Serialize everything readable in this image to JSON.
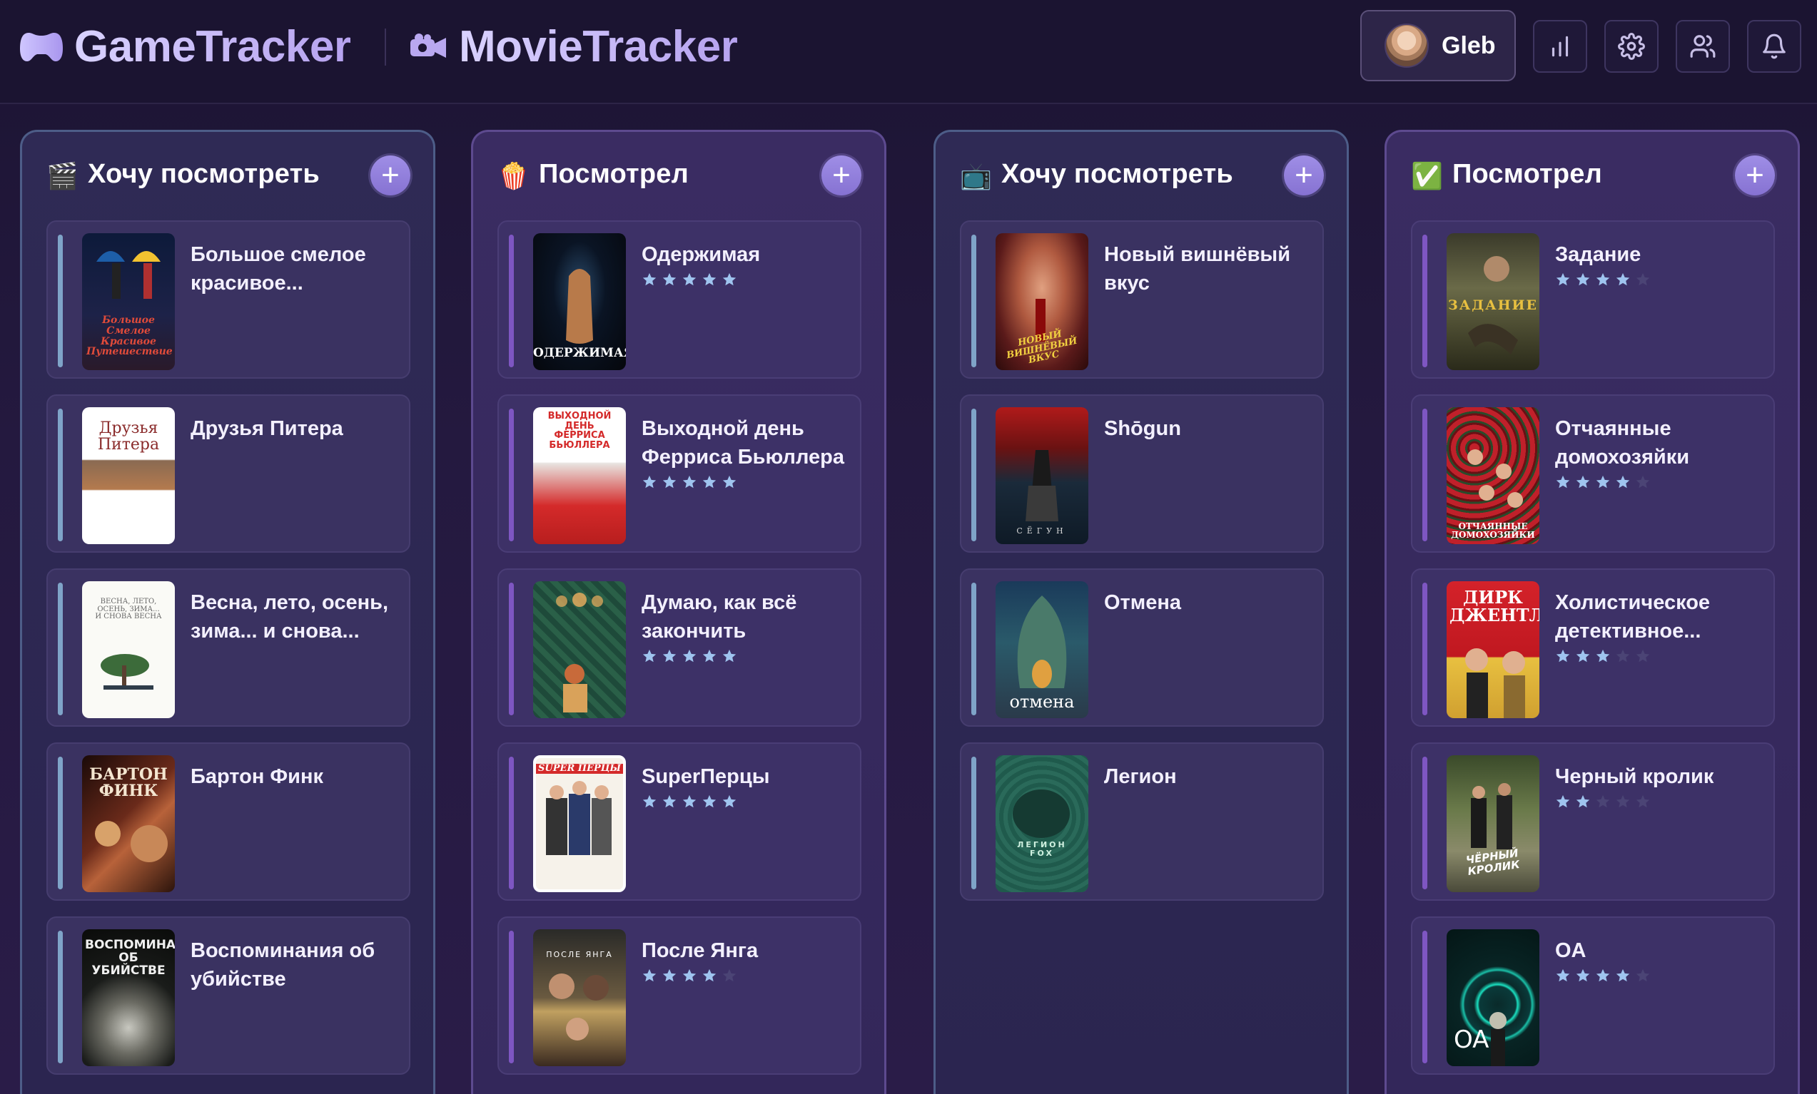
{
  "header": {
    "game_brand": "GameTracker",
    "movie_brand": "MovieTracker",
    "user_name": "Gleb",
    "icons": [
      "stats-icon",
      "settings-icon",
      "friends-icon",
      "bell-icon"
    ]
  },
  "colors": {
    "accent": "#8672d2",
    "blue_accent": "#7fa4c8",
    "purple_accent": "#7e56c2",
    "star_on": "#9fc4ef",
    "star_off": "#4b4475"
  },
  "columns": [
    {
      "emoji": "🎬",
      "title": "Хочу посмотреть",
      "cards": [
        {
          "title": "Большое смелое красивое...",
          "rating": null,
          "poster_text": "Большое Смелое Красивое Путешествие"
        },
        {
          "title": "Друзья Питера",
          "rating": null,
          "poster_text": "Друзья Питера"
        },
        {
          "title": "Весна, лето, осень, зима... и снова...",
          "rating": null,
          "poster_text": "ВЕСНА, ЛЕТО, ОСЕНЬ, ЗИМА... И СНОВА ВЕСНА"
        },
        {
          "title": "Бартон Финк",
          "rating": null,
          "poster_text": "БАРТОН ФИНК"
        },
        {
          "title": "Воспоминания об убийстве",
          "rating": null,
          "poster_text": "ВОСПОМИНАНИЯ ОБ УБИЙСТВЕ"
        }
      ]
    },
    {
      "emoji": "🍿",
      "title": "Посмотрел",
      "cards": [
        {
          "title": "Одержимая",
          "rating": 5,
          "poster_text": "ОДЕРЖИМАЯ"
        },
        {
          "title": "Выходной день Ферриса Бьюллера",
          "rating": 5,
          "poster_text": "ВЫХОДНОЙ ДЕНЬ ФЕРРИСА БЬЮЛЛЕРА"
        },
        {
          "title": "Думаю, как всё закончить",
          "rating": 5,
          "poster_text": ""
        },
        {
          "title": "SuperПерцы",
          "rating": 5,
          "poster_text": "SUPER ПЕРЦЫ"
        },
        {
          "title": "После Янга",
          "rating": 4,
          "poster_text": "ПОСЛЕ ЯНГА"
        }
      ]
    },
    {
      "emoji": "📺",
      "title": "Хочу посмотреть",
      "cards": [
        {
          "title": "Новый вишнёвый вкус",
          "rating": null,
          "poster_text": "НОВЫЙ ВИШНЁВЫЙ ВКУС"
        },
        {
          "title": "Shōgun",
          "rating": null,
          "poster_text": "СЁГУН"
        },
        {
          "title": "Отмена",
          "rating": null,
          "poster_text": "отмена"
        },
        {
          "title": "Легион",
          "rating": null,
          "poster_text": "ЛЕГИОН FOX"
        }
      ]
    },
    {
      "emoji": "✅",
      "title": "Посмотрел",
      "cards": [
        {
          "title": "Задание",
          "rating": 4,
          "poster_text": "ЗАДАНИЕ"
        },
        {
          "title": "Отчаянные домохозяйки",
          "rating": 4,
          "poster_text": "ОТЧАЯННЫЕ ДОМОХОЗЯЙКИ"
        },
        {
          "title": "Холистическое детективное...",
          "rating": 3,
          "poster_text": "ДИРК ДЖЕНТЛИ"
        },
        {
          "title": "Черный кролик",
          "rating": 2,
          "poster_text": "ЧЁРНЫЙ КРОЛИК"
        },
        {
          "title": "OA",
          "rating": 4,
          "poster_text": "OA"
        }
      ]
    }
  ]
}
